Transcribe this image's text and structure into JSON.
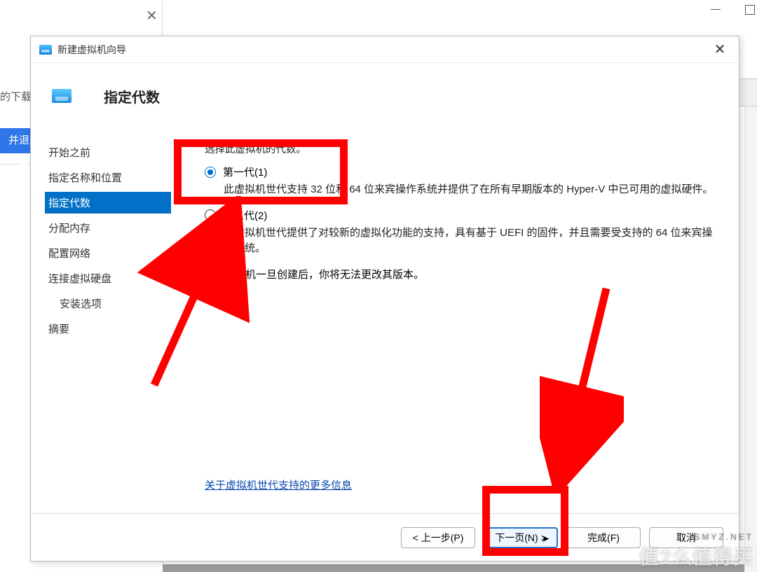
{
  "bg": {
    "download_label": "的下载",
    "exit_btn": "并退出"
  },
  "wizard": {
    "title": "新建虚拟机向导",
    "header": "指定代数",
    "nav": [
      {
        "label": "开始之前",
        "active": false
      },
      {
        "label": "指定名称和位置",
        "active": false
      },
      {
        "label": "指定代数",
        "active": true
      },
      {
        "label": "分配内存",
        "active": false
      },
      {
        "label": "配置网络",
        "active": false
      },
      {
        "label": "连接虚拟硬盘",
        "active": false
      },
      {
        "label": "安装选项",
        "active": false,
        "sub": true
      },
      {
        "label": "摘要",
        "active": false
      }
    ],
    "instruction": "选择此虚拟机的代数。",
    "option1": {
      "label": "第一代(1)",
      "desc": "此虚拟机世代支持 32 位和 64 位来宾操作系统并提供了在所有早期版本的 Hyper-V 中已可用的虚拟硬件。"
    },
    "option2": {
      "label": "第二代(2)",
      "desc": "此虚拟机世代提供了对较新的虚拟化功能的支持，具有基于 UEFI 的固件，并且需要受支持的 64 位来宾操作系统。"
    },
    "warning": "虚拟机一旦创建后，你将无法更改其版本。",
    "info_link": "关于虚拟机世代支持的更多信息",
    "buttons": {
      "prev": "< 上一步(P)",
      "next": "下一页(N) >",
      "finish": "完成(F)",
      "cancel": "取消"
    }
  },
  "watermark": "值?么值得买",
  "watermark_sub": "SMYZ.NET"
}
